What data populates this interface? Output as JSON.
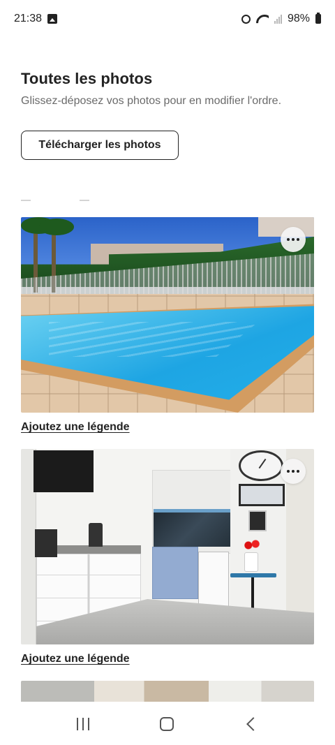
{
  "status_bar": {
    "time": "21:38",
    "battery": "98%"
  },
  "header": {
    "title": "Toutes les photos",
    "subtitle": "Glissez-déposez vos photos pour en modifier l'ordre."
  },
  "actions": {
    "upload_label": "Télécharger les photos"
  },
  "photos": [
    {
      "caption_link": "Ajoutez une légende"
    },
    {
      "caption_link": "Ajoutez une légende"
    }
  ],
  "colors": {
    "text_primary": "#222222",
    "text_secondary": "#6a6a6a",
    "background": "#ffffff"
  }
}
